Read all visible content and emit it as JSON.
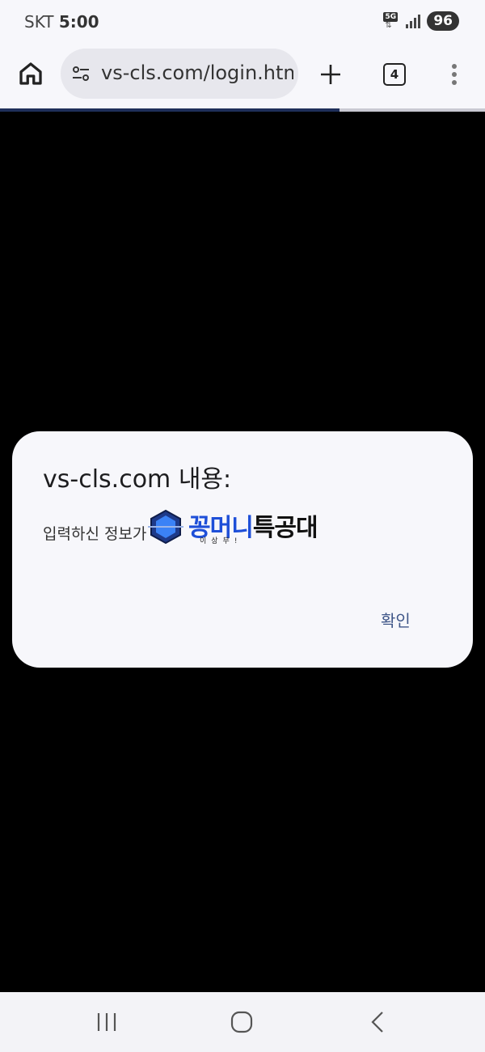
{
  "status_bar": {
    "carrier": "SKT",
    "time": "5:00",
    "network": "5G",
    "battery": "96"
  },
  "browser": {
    "url": "vs-cls.com/login.html",
    "tab_count": "4",
    "load_progress": 0.7
  },
  "dialog": {
    "title": "vs-cls.com 내용:",
    "message": "입력하신 정보가",
    "ok_label": "확인"
  },
  "watermark": {
    "title_part1": "꽁머니",
    "title_part2": "특공대",
    "subtitle": "이상무!"
  },
  "icons": {
    "home": "home-icon",
    "tune": "site-settings-icon",
    "new_tab": "plus-icon",
    "menu": "more-vert-icon",
    "recents": "recents-icon",
    "nav_home": "nav-home-icon",
    "back": "back-icon"
  }
}
